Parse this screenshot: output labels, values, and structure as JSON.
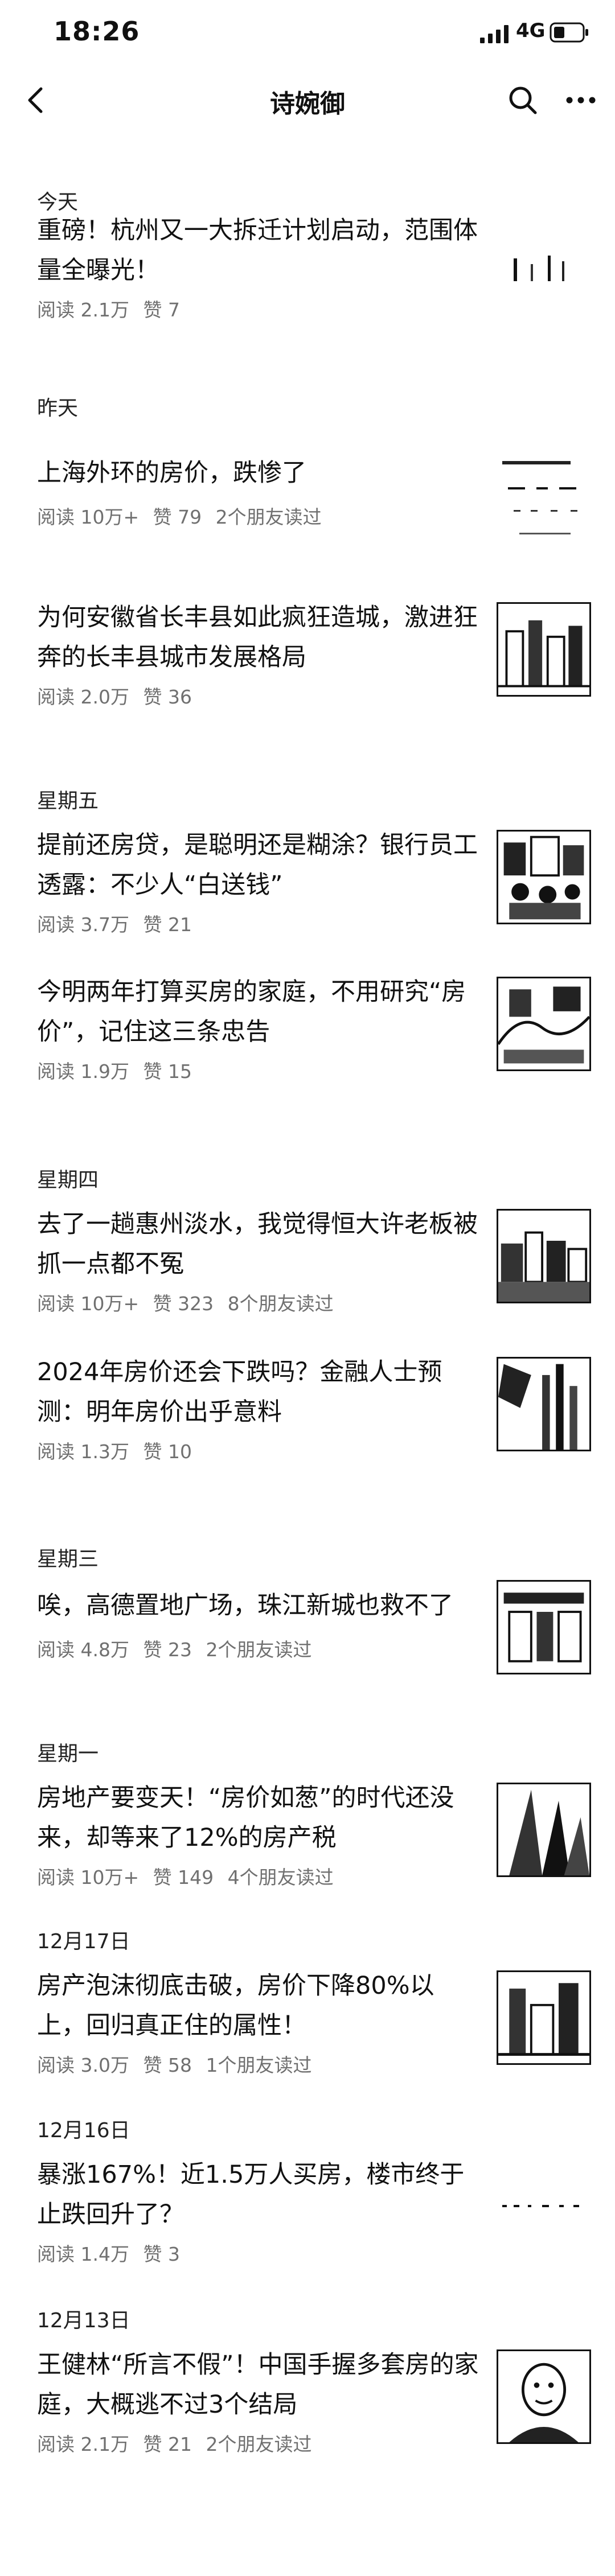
{
  "status": {
    "time": "18:26",
    "network": "4G"
  },
  "nav": {
    "title": "诗婉御"
  },
  "sections": [
    {
      "date": "今天",
      "articles": [
        {
          "title": "重磅！杭州又一大拆迁计划启动，范围体量全曝光！",
          "read": "阅读 2.1万",
          "like": "赞 7",
          "friends": ""
        }
      ]
    },
    {
      "date": "昨天",
      "articles": [
        {
          "title": "上海外环的房价，跌惨了",
          "read": "阅读 10万+",
          "like": "赞 79",
          "friends": "2个朋友读过"
        },
        {
          "title": "为何安徽省长丰县如此疯狂造城，激进狂奔的长丰县城市发展格局",
          "read": "阅读 2.0万",
          "like": "赞 36",
          "friends": ""
        }
      ]
    },
    {
      "date": "星期五",
      "articles": [
        {
          "title": "提前还房贷，是聪明还是糊涂？银行员工透露：不少人“白送钱”",
          "read": "阅读 3.7万",
          "like": "赞 21",
          "friends": ""
        },
        {
          "title": "今明两年打算买房的家庭，不用研究“房价”，记住这三条忠告",
          "read": "阅读 1.9万",
          "like": "赞 15",
          "friends": ""
        }
      ]
    },
    {
      "date": "星期四",
      "articles": [
        {
          "title": "去了一趟惠州淡水，我觉得恒大许老板被抓一点都不冤",
          "read": "阅读 10万+",
          "like": "赞 323",
          "friends": "8个朋友读过"
        },
        {
          "title": "2024年房价还会下跌吗？金融人士预测：明年房价出乎意料",
          "read": "阅读 1.3万",
          "like": "赞 10",
          "friends": ""
        }
      ]
    },
    {
      "date": "星期三",
      "articles": [
        {
          "title": "唉，高德置地广场，珠江新城也救不了",
          "read": "阅读 4.8万",
          "like": "赞 23",
          "friends": "2个朋友读过"
        }
      ]
    },
    {
      "date": "星期一",
      "articles": [
        {
          "title": "房地产要变天！“房价如葱”的时代还没来，却等来了12%的房产税",
          "read": "阅读 10万+",
          "like": "赞 149",
          "friends": "4个朋友读过"
        }
      ]
    },
    {
      "date": "12月17日",
      "articles": [
        {
          "title": "房产泡沫彻底击破，房价下降80%以上，回归真正住的属性！",
          "read": "阅读 3.0万",
          "like": "赞 58",
          "friends": "1个朋友读过"
        }
      ]
    },
    {
      "date": "12月16日",
      "articles": [
        {
          "title": "暴涨167%！近1.5万人买房，楼市终于止跌回升了？",
          "read": "阅读 1.4万",
          "like": "赞 3",
          "friends": ""
        }
      ]
    },
    {
      "date": "12月13日",
      "articles": [
        {
          "title": "王健林“所言不假”！中国手握多套房的家庭，大概逃不过3个结局",
          "read": "阅读 2.1万",
          "like": "赞 21",
          "friends": "2个朋友读过"
        }
      ]
    }
  ]
}
